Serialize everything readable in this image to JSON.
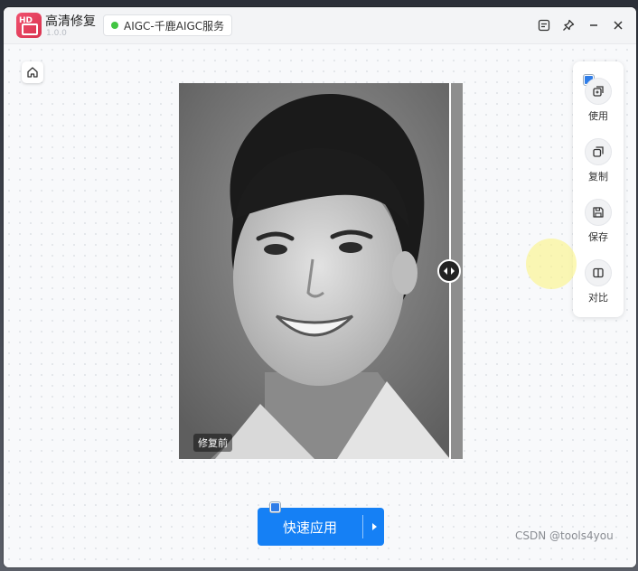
{
  "app": {
    "name": "高清修复",
    "version": "1.0.0",
    "logo_text": "HD"
  },
  "service": {
    "label": "AIGC-千鹿AIGC服务",
    "status_color": "#42c543"
  },
  "titlebar_buttons": [
    "screenshot-icon",
    "pin-icon",
    "minimize-icon",
    "close-icon"
  ],
  "image": {
    "before_label": "修复前",
    "compare_split": 0.955
  },
  "side_panel": {
    "items": [
      {
        "label": "使用",
        "icon": "use-icon"
      },
      {
        "label": "复制",
        "icon": "copy-icon"
      },
      {
        "label": "保存",
        "icon": "save-icon"
      },
      {
        "label": "对比",
        "icon": "compare-icon"
      }
    ]
  },
  "actions": {
    "apply_label": "快速应用",
    "accent": "#1580f5"
  },
  "watermark": "CSDN @tools4you"
}
